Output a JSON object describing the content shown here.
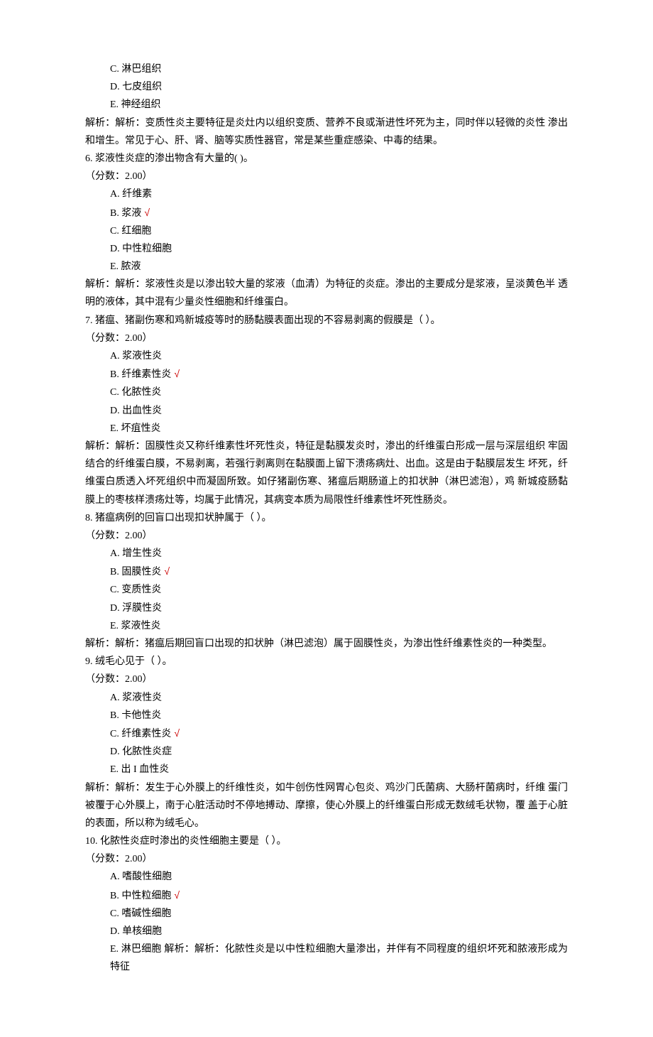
{
  "prevQuestionOptions": [
    "C. 淋巴组织",
    "D. 七皮组织",
    "E. 神经组织"
  ],
  "prevExplanation": "解析：解析：变质性炎主要特征是炎灶内以组织变质、营养不良或渐进性坏死为主，同时伴以轻微的炎性 渗出和增生。常见于心、肝、肾、脑等实质性器官，常是某些重症感染、中毒的结果。",
  "q6": {
    "stem": "6. 浆液性炎症的渗出物含有大量的( )。",
    "score": "（分数：2.00）",
    "opts": [
      "A. 纤维素",
      "B. 浆液",
      "C. 红细胞",
      "D. 中性粒细胞",
      "E. 脓液"
    ],
    "correct": 1,
    "explain": "解析：解析：浆液性炎是以渗出较大量的浆液（血清）为特征的炎症。渗出的主要成分是浆液，呈淡黄色半 透明的液体，其中混有少量炎性细胞和纤维蛋白。"
  },
  "q7": {
    "stem": "7. 猪瘟、猪副伤寒和鸡新城疫等时的肠黏膜表面出现的不容易剥离的假膜是（ ）。",
    "score": "（分数：2.00）",
    "opts": [
      "A. 浆液性炎",
      "B. 纤维素性炎",
      "C. 化脓性炎",
      "D. 出血性炎",
      "E. 坏疽性炎"
    ],
    "correct": 1,
    "explain": "解析：解析：固膜性炎又称纤维素性坏死性炎，特征是黏膜发炎时，渗出的纤维蛋白形成一层与深层组织 牢固结合的纤维蛋白膜，不易剥离，若强行剥离则在黏膜面上留下溃疡病灶、出血。这是由于黏膜层发生 坏死，纤维蛋白质透入坏死组织中而凝固所致。如仔猪副伤寒、猪瘟后期肠道上的扣状肿（淋巴滤泡），鸡 新城疫肠黏膜上的枣核样溃疡灶等，均属于此情况，其病变本质为局限性纤维素性坏死性肠炎。"
  },
  "q8": {
    "stem": "8. 猪瘟病例的回盲口出现扣状肿属于（ ）。",
    "score": "（分数：2.00）",
    "opts": [
      "A. 增生性炎",
      "B. 固膜性炎",
      "C. 变质性炎",
      "D. 浮膜性炎",
      "E. 浆液性炎"
    ],
    "correct": 1,
    "explain": "解析：解析：猪瘟后期回盲口出现的扣状肿（淋巴滤泡）属于固膜性炎，为渗出性纤维素性炎的一种类型。"
  },
  "q9": {
    "stem": "9. 绒毛心见于（ ）。",
    "score": "（分数：2.00）",
    "opts": [
      "A. 浆液性炎",
      "B. 卡他性炎",
      "C. 纤维素性炎",
      "D. 化脓性炎症",
      "E. 出 I 血性炎"
    ],
    "correct": 2,
    "explain": "解析：解析：发生于心外膜上的纤维性炎，如牛创伤性网胃心包炎、鸡沙门氏菌病、大肠杆菌病时，纤维 蛋门被覆于心外膜上，南于心脏活动时不停地搏动、摩擦，使心外膜上的纤维蛋白形成无数绒毛状物，覆 盖于心脏的表面，所以称为绒毛心。"
  },
  "q10": {
    "stem": "10. 化脓性炎症时渗出的炎性细胞主要是（ ）。",
    "score": "（分数：2.00）",
    "opts": [
      "A. 嗜酸性细胞",
      "B. 中性粒细胞",
      "C. 嗜碱性细胞",
      "D. 单核细胞"
    ],
    "correct": 1,
    "lastOpt": "E. 淋巴细胞 解析：解析：化脓性炎是以中性粒细胞大量渗出，并伴有不同程度的组织坏死和脓液形成为特征"
  },
  "checkMark": "√"
}
